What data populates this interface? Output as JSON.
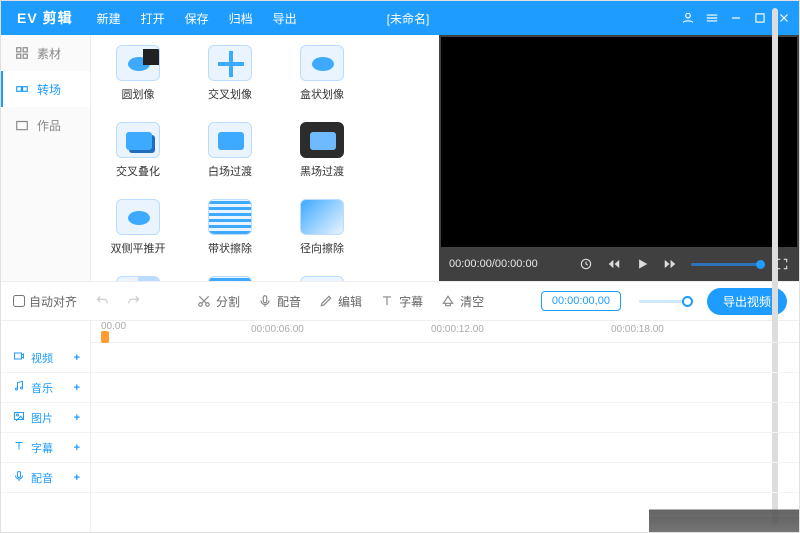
{
  "titlebar": {
    "logo": "EV 剪辑",
    "menu": [
      "新建",
      "打开",
      "保存",
      "归档",
      "导出"
    ],
    "doc": "[未命名]"
  },
  "sidebar": {
    "items": [
      {
        "label": "素材",
        "active": false
      },
      {
        "label": "转场",
        "active": true
      },
      {
        "label": "作品",
        "active": false
      }
    ]
  },
  "transitions": [
    {
      "label": "圆划像",
      "variant": "blob",
      "covered": true
    },
    {
      "label": "交叉划像",
      "variant": "star"
    },
    {
      "label": "盒状划像",
      "variant": "blob"
    },
    {
      "label": "交叉叠化",
      "variant": "tworect"
    },
    {
      "label": "白场过渡",
      "variant": "rect"
    },
    {
      "label": "黑场过渡",
      "variant": "dark"
    },
    {
      "label": "双侧平推开",
      "variant": "blob"
    },
    {
      "label": "带状擦除",
      "variant": "lines"
    },
    {
      "label": "径向擦除",
      "variant": "grad"
    },
    {
      "label": "",
      "variant": "split"
    },
    {
      "label": "",
      "variant": "lines"
    },
    {
      "label": "",
      "variant": "dots"
    }
  ],
  "preview": {
    "time": "00:00:00/00:00:00"
  },
  "toolbar": {
    "autoalign": "自动对齐",
    "tools": [
      {
        "label": "分割",
        "icon": "cut"
      },
      {
        "label": "配音",
        "icon": "mic"
      },
      {
        "label": "编辑",
        "icon": "pen"
      },
      {
        "label": "字幕",
        "icon": "text"
      },
      {
        "label": "清空",
        "icon": "clear"
      }
    ],
    "timecode": "00:00:00,00",
    "export": "导出视频"
  },
  "ruler": {
    "start": "00.00",
    "ticks": [
      {
        "label": "00:00:06.00",
        "pos": 160
      },
      {
        "label": "00:00:12.00",
        "pos": 340
      },
      {
        "label": "00:00:18.00",
        "pos": 520
      }
    ]
  },
  "tracks": [
    {
      "label": "视频",
      "icon": "video"
    },
    {
      "label": "音乐",
      "icon": "music"
    },
    {
      "label": "图片",
      "icon": "image"
    },
    {
      "label": "字幕",
      "icon": "text"
    },
    {
      "label": "配音",
      "icon": "mic"
    }
  ]
}
